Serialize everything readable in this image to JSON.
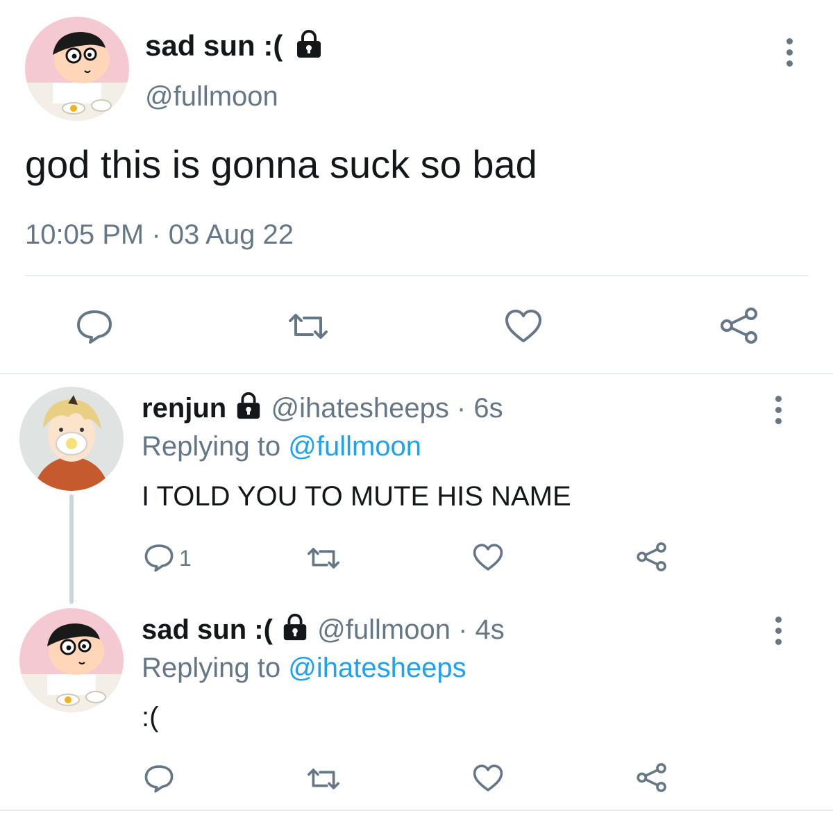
{
  "main_tweet": {
    "display_name": "sad sun :(",
    "handle": "@fullmoon",
    "text": "god this is gonna suck so bad",
    "timestamp": "10:05 PM · 03 Aug 22"
  },
  "replies": [
    {
      "display_name": "renjun",
      "handle_time": "@ihatesheeps · 6s",
      "replying_prefix": "Replying to",
      "replying_to": "@fullmoon",
      "text": "I TOLD YOU TO MUTE HIS NAME",
      "reply_count": "1"
    },
    {
      "display_name": "sad sun :(",
      "handle_time": "@fullmoon · 4s",
      "replying_prefix": "Replying to",
      "replying_to": "@ihatesheeps",
      "text": ":("
    }
  ],
  "icons": {
    "reply": "reply-icon",
    "retweet": "retweet-icon",
    "like": "heart-icon",
    "share": "share-icon",
    "lock": "lock-icon",
    "more": "more-vertical-icon"
  },
  "colors": {
    "text": "#14171a",
    "secondary": "#657786",
    "link": "#1da1f2",
    "divider": "#e6ecf0"
  }
}
